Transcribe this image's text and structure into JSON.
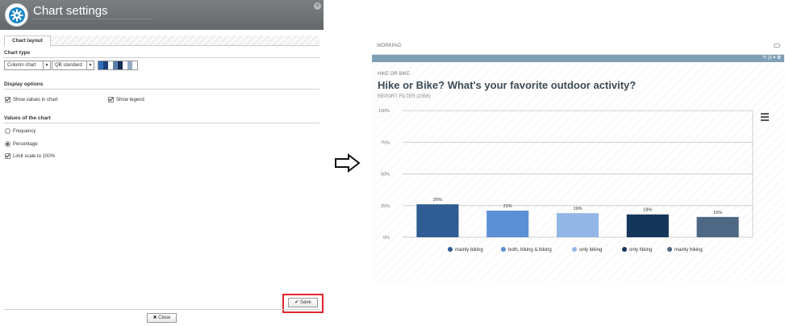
{
  "dialog": {
    "title": "Chart settings",
    "close_glyph": "✕",
    "tab_label": "Chart layout",
    "sections": {
      "chart_type": "Chart type",
      "display_options": "Display options",
      "values": "Values of the chart"
    },
    "chart_type_select": "Column chart",
    "palette_select": "QB standard",
    "palette_colors": [
      "#2f6fb8",
      "#1f3f7a",
      "#ffffff",
      "#5c7fa8",
      "#142f55",
      "#ffffff",
      "#93abc5",
      "#ffffff"
    ],
    "show_values": {
      "label": "Show values in chart",
      "checked": true
    },
    "show_legend": {
      "label": "Show legend",
      "checked": true
    },
    "frequency": {
      "label": "Frequency",
      "selected": false
    },
    "percentage": {
      "label": "Percentage",
      "selected": true
    },
    "limit_scale": {
      "label": "Limit scale to 100%",
      "checked": true
    },
    "save_label": "Save",
    "close_label": "Close"
  },
  "workpad": {
    "label": "WORKPAD",
    "kicker": "HIKE OR BIKE",
    "headline": "Hike or Bike? What's your favorite outdoor activity?",
    "filter": "REPORT FILTER (2356)",
    "toolbar_tools": "✎  |ıl ▾  ✿"
  },
  "chart_data": {
    "type": "bar",
    "categories": [
      "mainly biking",
      "both, hiking & biking",
      "only biking",
      "only hiking",
      "mainly hiking"
    ],
    "values": [
      26,
      21,
      19,
      18,
      16
    ],
    "data_labels": [
      "26%",
      "21%",
      "19%",
      "18%",
      "16%"
    ],
    "colors": [
      "#2e5c93",
      "#5b8fd6",
      "#92b7e6",
      "#143659",
      "#4e6785"
    ],
    "ylim": [
      0,
      100
    ],
    "y_ticks": [
      0,
      25,
      50,
      75,
      100
    ],
    "y_tick_labels": [
      "0%",
      "25%",
      "50%",
      "75%",
      "100%"
    ],
    "legend_position": "bottom",
    "grid": true
  }
}
